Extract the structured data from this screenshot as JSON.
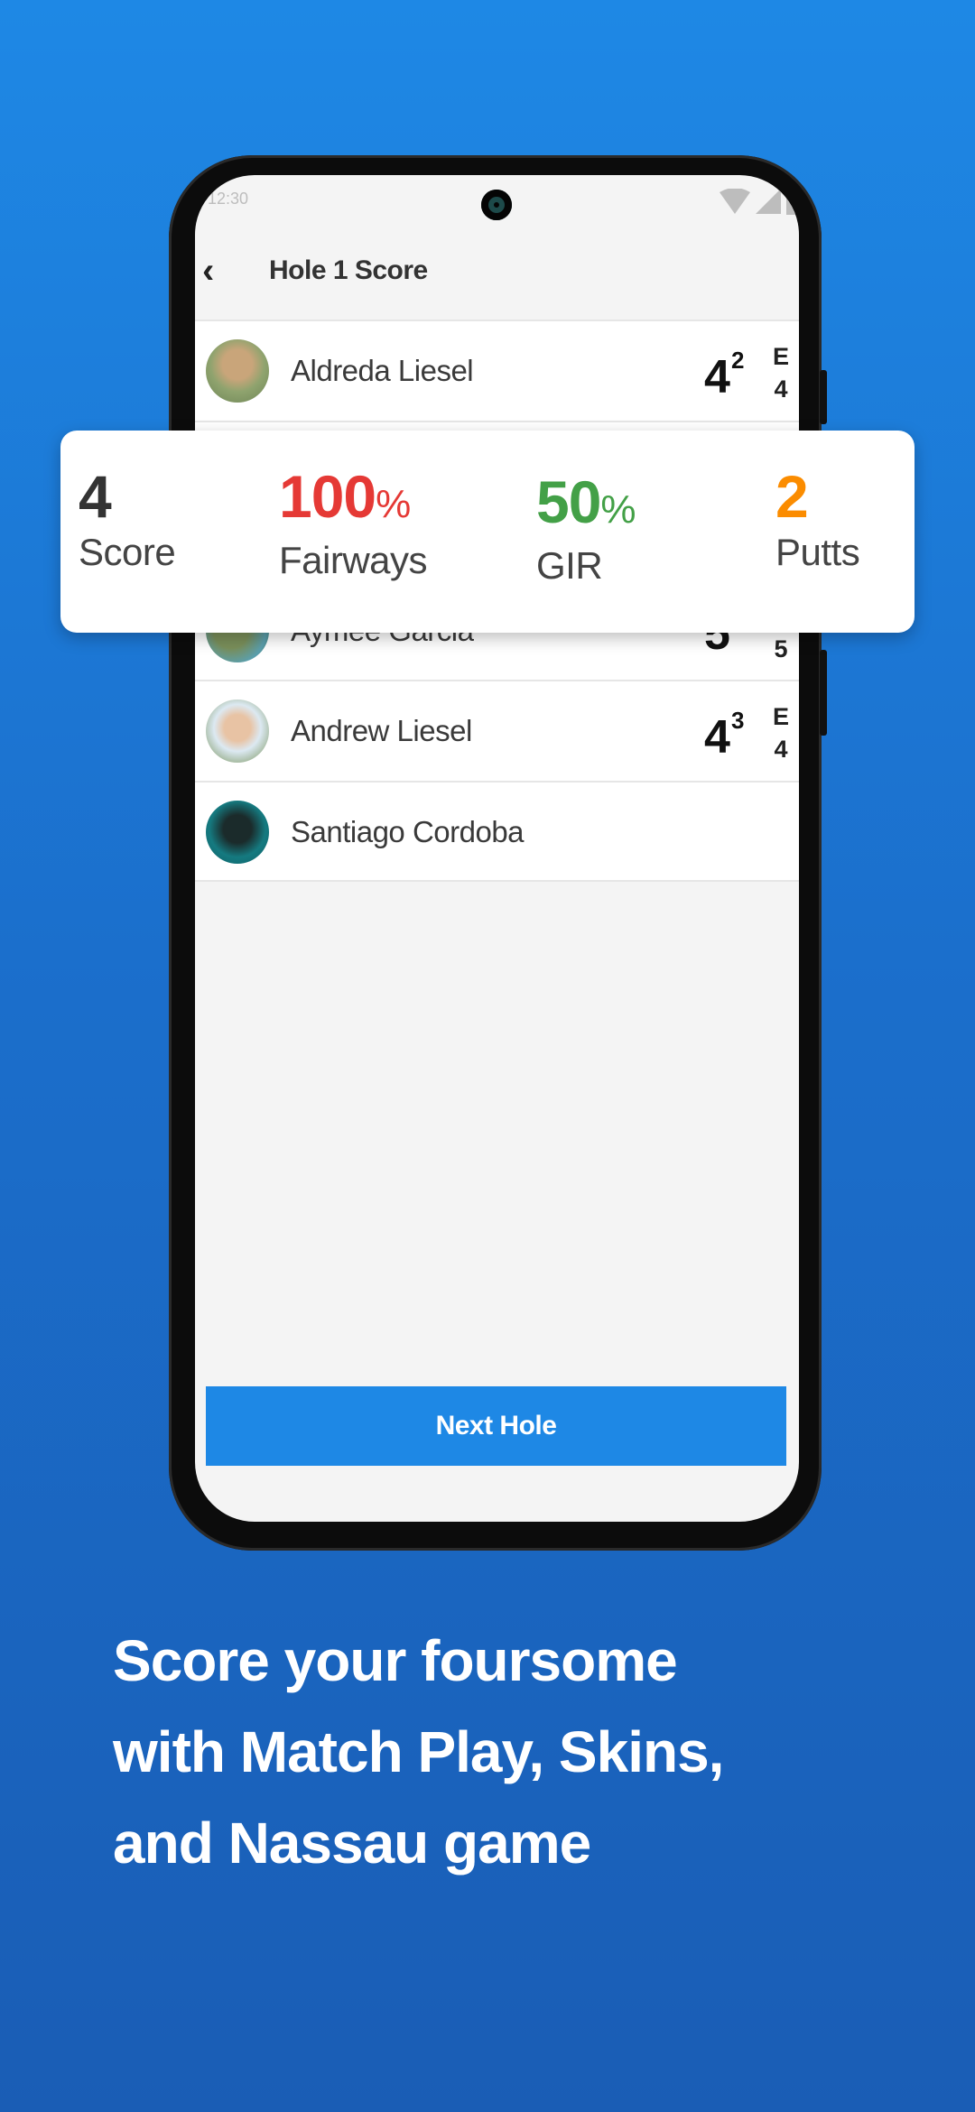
{
  "status_bar": {
    "time": "12:30",
    "icons": [
      "wifi-icon",
      "cellular-signal-icon",
      "battery-icon"
    ]
  },
  "header": {
    "back_icon": "chevron-left-icon",
    "back_glyph": "‹",
    "title": "Hole 1 Score"
  },
  "players": [
    {
      "name": "Aldreda Liesel",
      "score": "4",
      "putts": "2",
      "to_par": "E",
      "total": "4"
    },
    {
      "name": "Aymee Garcia",
      "score": "5",
      "putts": "",
      "to_par": "",
      "total": "5"
    },
    {
      "name": "Andrew Liesel",
      "score": "4",
      "putts": "3",
      "to_par": "E",
      "total": "4"
    },
    {
      "name": "Santiago Cordoba",
      "score": "",
      "putts": "",
      "to_par": "",
      "total": ""
    }
  ],
  "stats_card": {
    "score": {
      "value": "4",
      "label": "Score",
      "color": "#333333"
    },
    "fairways": {
      "value": "100",
      "unit": "%",
      "label": "Fairways",
      "color": "#e53935"
    },
    "gir": {
      "value": "50",
      "unit": "%",
      "label": "GIR",
      "color": "#43a047"
    },
    "putts": {
      "value": "2",
      "label": "Putts",
      "color": "#fb8c00"
    }
  },
  "next_button": {
    "label": "Next Hole",
    "color": "#1e88e5"
  },
  "tagline": {
    "line1": "Score your foursome",
    "line2": "with Match Play, Skins,",
    "line3": "and Nassau game"
  }
}
